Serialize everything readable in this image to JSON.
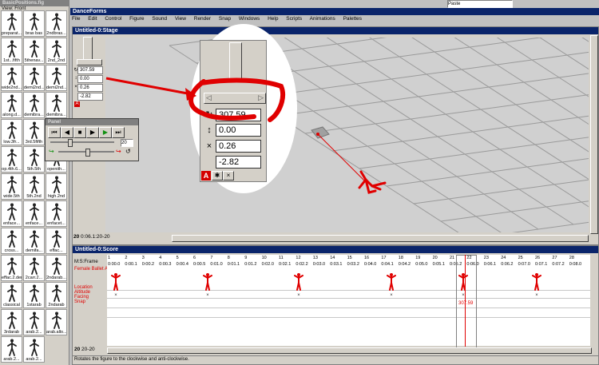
{
  "library": {
    "title": "BasicPositions.fig",
    "view_label": "View: Front",
    "items": [
      "preparat...",
      "bras bas",
      "2ndbras...",
      "1st...fifth",
      "5thenav...",
      "2nd_2nd",
      "wide2nd...",
      "demi2nd...",
      "demi2nd...",
      "along.d...",
      "demibra...",
      "demibra...",
      "low.3fr...",
      "3rd.5fifth",
      "arabes...",
      "op.4th.6...",
      "5th.5th",
      "openith...",
      "wide.5th",
      "5th.2nd",
      "high.2nd",
      "enface...",
      "enface...",
      "enfacet...",
      "cross...",
      "demifa...",
      "effac...",
      "effac.2.der",
      "2carr.2...",
      "2ndarab...",
      "classical",
      "1starab",
      "2ndarab",
      "3rdarab",
      "arab.2...",
      "arab.allo...",
      "arab.2...",
      "arab.2..."
    ]
  },
  "app": {
    "title": "DanceForms",
    "menu": [
      "File",
      "Edit",
      "Control",
      "Figure",
      "Sound",
      "View",
      "Render",
      "Snap",
      "Windows",
      "Help",
      "Scripts",
      "Animations",
      "Palettes"
    ],
    "top_right_field": "Paste"
  },
  "stage": {
    "title": "Untitled-0:Stage",
    "frame_label": "20",
    "frame_time": "0:06.1:20-20",
    "controls": {
      "rotate": "307.59",
      "altitude": "0.00",
      "facing": "0.26",
      "snap": "-2.82"
    }
  },
  "zoom": {
    "rotate": "307.59",
    "altitude": "0.00",
    "facing": "0.26",
    "snap": "-2.82",
    "icons": {
      "rotate": "rotate-icon",
      "altitude": "updown-icon",
      "facing": "x-icon"
    }
  },
  "panel": {
    "title": "Panel",
    "speed_value": "20"
  },
  "score": {
    "title": "Untitled-0:Score",
    "header_label": "M:S:Frame",
    "track_name": "Female Ballet A",
    "rows": [
      "Location",
      "Altitude",
      "Facing",
      "Snap"
    ],
    "ticks": [
      "1",
      "2",
      "3",
      "4",
      "5",
      "6",
      "7",
      "8",
      "9",
      "10",
      "11",
      "12",
      "13",
      "14",
      "15",
      "16",
      "17",
      "18",
      "19",
      "20",
      "21",
      "22",
      "23",
      "24",
      "25",
      "26",
      "27",
      "28"
    ],
    "times": [
      "0:00.0",
      "0:00.1",
      "0:00.2",
      "0:00.3",
      "0:00.4",
      "0:00.5",
      "0:01.0",
      "0:01.1",
      "0:01.2",
      "0:02.0",
      "0:02.1",
      "0:02.2",
      "0:03.0",
      "0:03.1",
      "0:03.2",
      "0:04.0",
      "0:04.1",
      "0:04.2",
      "0:05.0",
      "0:05.1",
      "0:05.2",
      "0:06.0",
      "0:06.1",
      "0:06.2",
      "0:07.0",
      "0:07.1",
      "0:07.2",
      "0:08.0",
      "0:08.1"
    ],
    "current_frame": "20",
    "current_time": "0:06.1",
    "selected_value": "307.59",
    "footer_frame": "20",
    "footer_range": "20-20",
    "status": "Rotates the figure to the clockwise and anti-clockwise."
  }
}
